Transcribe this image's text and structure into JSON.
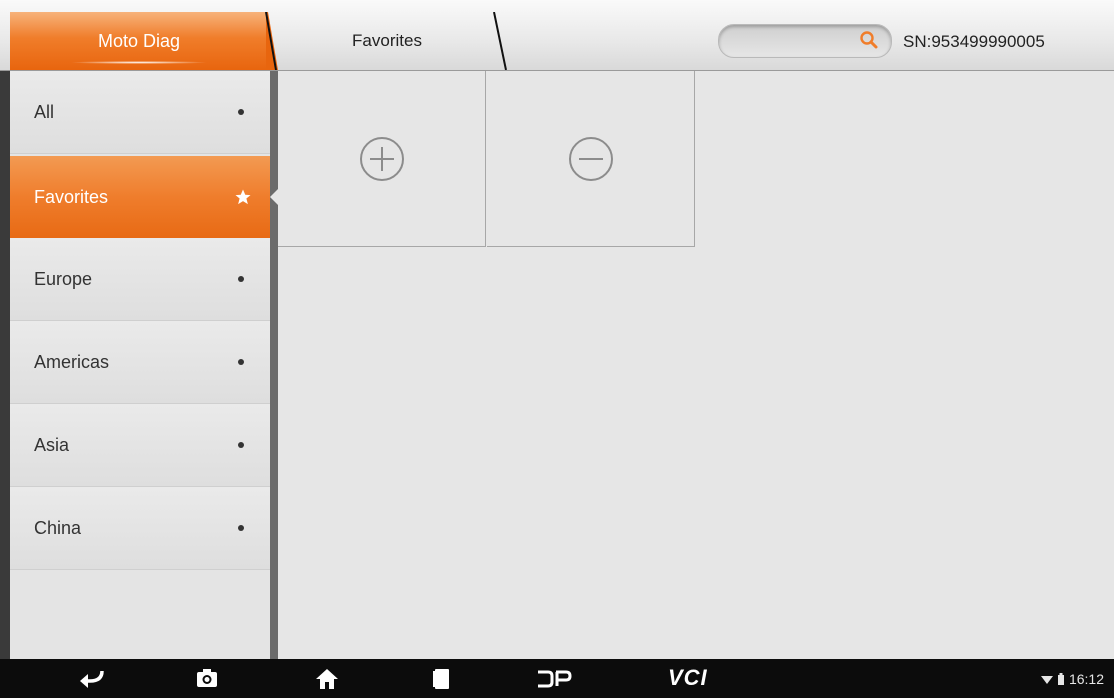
{
  "header": {
    "active_tab": "Moto Diag",
    "second_tab": "Favorites",
    "search": {
      "value": "",
      "placeholder": ""
    },
    "serial": "SN:953499990005"
  },
  "sidebar": {
    "items": [
      {
        "label": "All",
        "marker": "dot"
      },
      {
        "label": "Favorites",
        "marker": "star-icon",
        "active": true
      },
      {
        "label": "Europe",
        "marker": "dot"
      },
      {
        "label": "Americas",
        "marker": "dot"
      },
      {
        "label": "Asia",
        "marker": "dot"
      },
      {
        "label": "China",
        "marker": "dot"
      }
    ]
  },
  "main": {
    "tiles": [
      {
        "icon": "add-circle-icon"
      },
      {
        "icon": "remove-circle-icon"
      }
    ]
  },
  "navbar": {
    "buttons": [
      "back-icon",
      "screenshot-icon",
      "home-icon",
      "recents-icon",
      "dp-icon",
      "vci-icon"
    ],
    "vci_label": "VCI",
    "time": "16:12"
  },
  "colors": {
    "accent": "#ef7d2c",
    "background": "#e6e6e6",
    "navbar": "#0c0c0c"
  }
}
